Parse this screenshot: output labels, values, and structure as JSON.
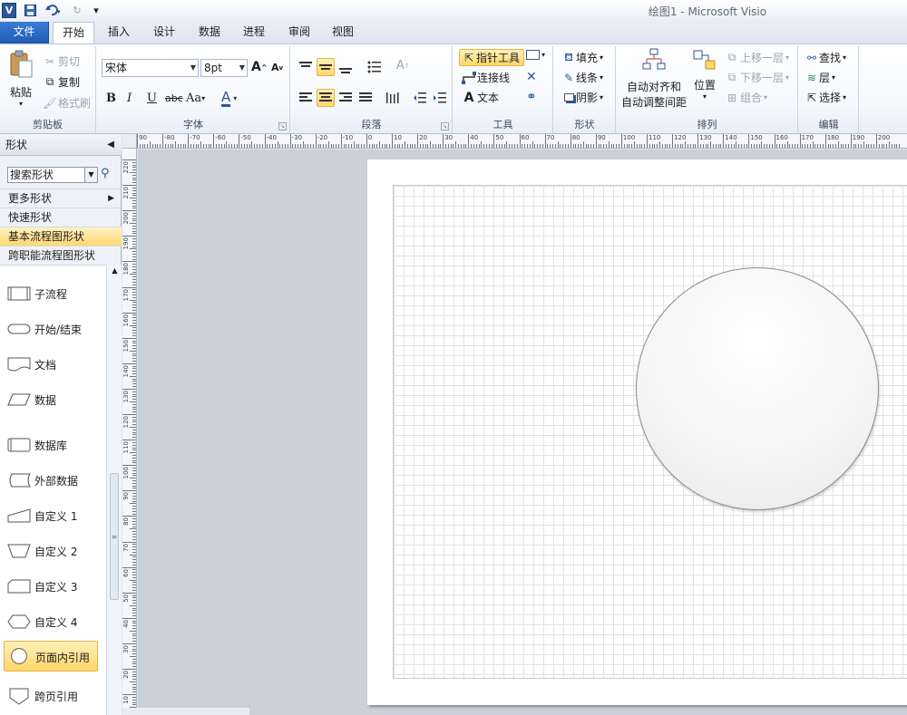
{
  "title": "绘图1 - Microsoft Visio",
  "quick_access": {
    "logo": "V"
  },
  "tabs": [
    "文件",
    "开始",
    "插入",
    "设计",
    "数据",
    "进程",
    "审阅",
    "视图"
  ],
  "ribbon": {
    "clipboard": {
      "label": "剪贴板",
      "paste": "粘贴",
      "cut": "剪切",
      "copy": "复制",
      "format_painter": "格式刷"
    },
    "font": {
      "label": "字体",
      "font_name": "宋体",
      "font_size": "8pt",
      "bold": "B",
      "italic": "I",
      "underline": "U",
      "strike": "abc",
      "case": "Aa",
      "color": "A"
    },
    "paragraph": {
      "label": "段落"
    },
    "tools": {
      "label": "工具",
      "pointer": "指针工具",
      "connector": "连接线",
      "text": "文本"
    },
    "shape": {
      "label": "形状",
      "fill": "填充",
      "line": "线条",
      "shadow": "阴影"
    },
    "arrange": {
      "label": "排列",
      "auto_align_1": "自动对齐和",
      "auto_align_2": "自动调整间距",
      "position": "位置",
      "bring_forward": "上移一层",
      "send_backward": "下移一层",
      "group": "组合"
    },
    "editing": {
      "label": "编辑",
      "find": "查找",
      "layers": "层",
      "select": "选择"
    }
  },
  "shapes_pane": {
    "header": "形状",
    "search_value": "搜索形状",
    "more_shapes": "更多形状",
    "quick_shapes": "快速形状",
    "basic_flowchart": "基本流程图形状",
    "cross_functional": "跨职能流程图形状",
    "items": [
      "子流程",
      "开始/结束",
      "文档",
      "数据",
      "数据库",
      "外部数据",
      "自定义 1",
      "自定义 2",
      "自定义 3",
      "自定义 4",
      "页面内引用",
      "跨页引用"
    ]
  },
  "ruler_labels": {
    "horizontal": [
      "90",
      "-80",
      "-70",
      "-60",
      "-50",
      "-40",
      "-30",
      "-20",
      "-10",
      "0",
      "10",
      "20",
      "30",
      "40",
      "50",
      "60",
      "70",
      "80",
      "90",
      "100",
      "110",
      "120",
      "130",
      "140",
      "150",
      "160",
      "170",
      "180",
      "190",
      "200"
    ],
    "vertical": [
      "220",
      "210",
      "200",
      "190",
      "180",
      "170",
      "160",
      "150",
      "140",
      "130",
      "120",
      "110",
      "100",
      "90",
      "80",
      "70",
      "60",
      "50",
      "40",
      "30",
      "20",
      "10"
    ]
  },
  "colors": {
    "accent": "#2b579a",
    "highlight": "#ffd76a",
    "annotation": "#e02020"
  }
}
